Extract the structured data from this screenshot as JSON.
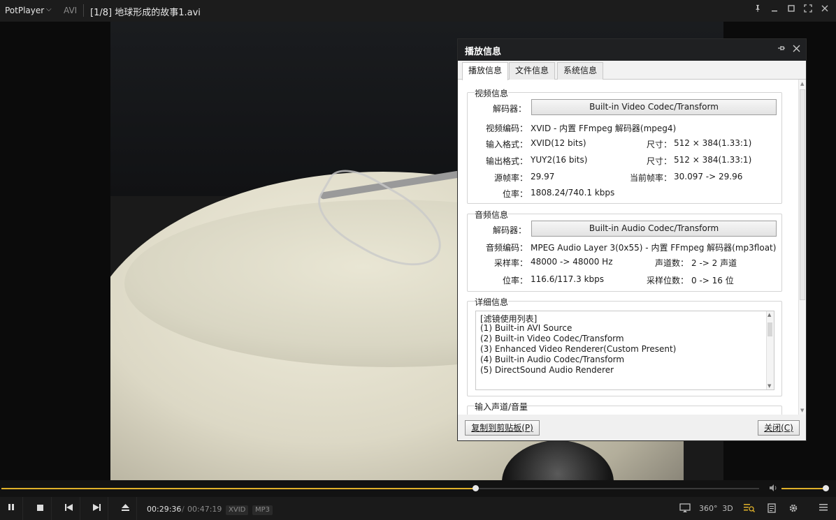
{
  "titlebar": {
    "brand": "PotPlayer",
    "format": "AVI",
    "title": "[1/8]  地球形成的故事1.avi"
  },
  "dialog": {
    "title": "播放信息",
    "tabs": [
      "播放信息",
      "文件信息",
      "系统信息"
    ],
    "video": {
      "group": "视频信息",
      "decoder_label": "解码器：",
      "decoder": "Built-in Video Codec/Transform",
      "codec_label": "视频编码：",
      "codec": "XVID - 内置 FFmpeg 解码器(mpeg4)",
      "in_fmt_label": "输入格式：",
      "in_fmt": "XVID(12 bits)",
      "in_size_label": "尺寸：",
      "in_size": "512 × 384(1.33:1)",
      "out_fmt_label": "输出格式：",
      "out_fmt": "YUY2(16 bits)",
      "out_size_label": "尺寸：",
      "out_size": "512 × 384(1.33:1)",
      "src_fps_label": "源帧率：",
      "src_fps": "29.97",
      "cur_fps_label": "当前帧率：",
      "cur_fps": "30.097 -> 29.96",
      "bitrate_label": "位率：",
      "bitrate": "1808.24/740.1 kbps"
    },
    "audio": {
      "group": "音频信息",
      "decoder_label": "解码器：",
      "decoder": "Built-in Audio Codec/Transform",
      "codec_label": "音频编码：",
      "codec": "MPEG Audio Layer 3(0x55) - 内置 FFmpeg 解码器(mp3float)",
      "samplerate_label": "采样率：",
      "samplerate": "48000 -> 48000 Hz",
      "channels_label": "声道数：",
      "channels": "2 -> 2 声道",
      "bitrate_label": "位率：",
      "bitrate": "116.6/117.3 kbps",
      "bits_label": "采样位数：",
      "bits": "0 -> 16 位"
    },
    "details": {
      "group": "详细信息",
      "lines": [
        "[滤镜使用列表]",
        "  (1) Built-in AVI Source",
        "  (2) Built-in Video Codec/Transform",
        "  (3) Enhanced Video Renderer(Custom Present)",
        "  (4) Built-in Audio Codec/Transform",
        "  (5) DirectSound Audio Renderer"
      ]
    },
    "input_group": "输入声道/音量",
    "copy_button": "复制到剪贴板(P)",
    "close_button": "关闭(C)"
  },
  "playback": {
    "progress": 0.625,
    "volume": 0.96,
    "current_time": "00:29:36",
    "separator": "/",
    "total_time": "00:47:19",
    "badges": [
      "XVID",
      "MP3"
    ],
    "right_icons": [
      "360°",
      "3D"
    ]
  },
  "colors": {
    "accent": "#e0b12a",
    "dialog_title_bg": "#1f2022"
  }
}
